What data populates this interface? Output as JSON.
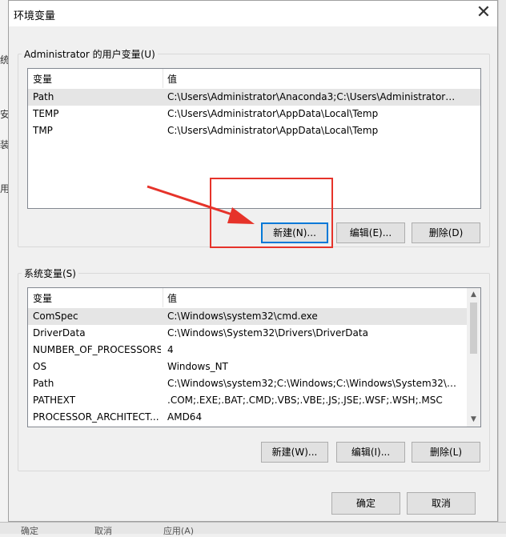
{
  "background": {
    "left_fragments": [
      "统",
      "安",
      "装",
      "用"
    ],
    "bottom_buttons": [
      "确定",
      "取消",
      "应用(A)"
    ]
  },
  "dialog": {
    "title": "环境变量",
    "close_glyph": "✕"
  },
  "user_vars": {
    "group_label": "Administrator 的用户变量(U)",
    "columns": [
      "变量",
      "值"
    ],
    "rows": [
      {
        "name": "Path",
        "value": "C:\\Users\\Administrator\\Anaconda3;C:\\Users\\Administrator\\A...",
        "selected": true
      },
      {
        "name": "TEMP",
        "value": "C:\\Users\\Administrator\\AppData\\Local\\Temp",
        "selected": false
      },
      {
        "name": "TMP",
        "value": "C:\\Users\\Administrator\\AppData\\Local\\Temp",
        "selected": false
      }
    ],
    "buttons": {
      "new": "新建(N)...",
      "edit": "编辑(E)...",
      "delete": "删除(D)"
    }
  },
  "system_vars": {
    "group_label": "系统变量(S)",
    "columns": [
      "变量",
      "值"
    ],
    "rows": [
      {
        "name": "ComSpec",
        "value": "C:\\Windows\\system32\\cmd.exe",
        "selected": true
      },
      {
        "name": "DriverData",
        "value": "C:\\Windows\\System32\\Drivers\\DriverData",
        "selected": false
      },
      {
        "name": "NUMBER_OF_PROCESSORS",
        "value": "4",
        "selected": false
      },
      {
        "name": "OS",
        "value": "Windows_NT",
        "selected": false
      },
      {
        "name": "Path",
        "value": "C:\\Windows\\system32;C:\\Windows;C:\\Windows\\System32\\Wb...",
        "selected": false
      },
      {
        "name": "PATHEXT",
        "value": ".COM;.EXE;.BAT;.CMD;.VBS;.VBE;.JS;.JSE;.WSF;.WSH;.MSC",
        "selected": false
      },
      {
        "name": "PROCESSOR_ARCHITECT...",
        "value": "AMD64",
        "selected": false
      }
    ],
    "buttons": {
      "new": "新建(W)...",
      "edit": "编辑(I)...",
      "delete": "删除(L)"
    }
  },
  "footer": {
    "ok": "确定",
    "cancel": "取消"
  },
  "colors": {
    "annotation": "#e6332a",
    "focus": "#0078d7"
  }
}
